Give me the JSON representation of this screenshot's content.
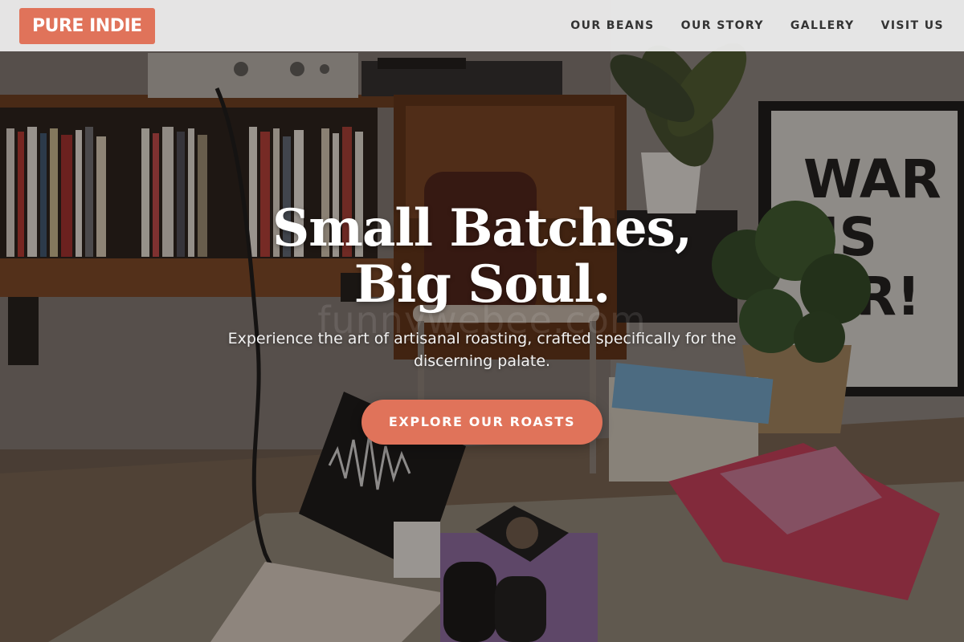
{
  "navbar": {
    "logo_text": "PURE INDIE",
    "links": [
      "OUR BEANS",
      "OUR STORY",
      "GALLERY",
      "VISIT US"
    ]
  },
  "hero": {
    "headline_line1": "Small Batches,",
    "headline_line2": "Big Soul.",
    "subtext": "Experience the art of artisanal roasting, crafted specifically for the discerning palate.",
    "cta_label": "EXPLORE OUR ROASTS",
    "poster_text_line1": "WAR",
    "poster_text_line2": "IS",
    "poster_text_line3": "ER!",
    "watermark": "funnywebee.com"
  },
  "colors": {
    "accent": "#e0735a",
    "nav_background": "#eeeeee",
    "nav_text": "#333333",
    "headline": "#ffffff"
  }
}
